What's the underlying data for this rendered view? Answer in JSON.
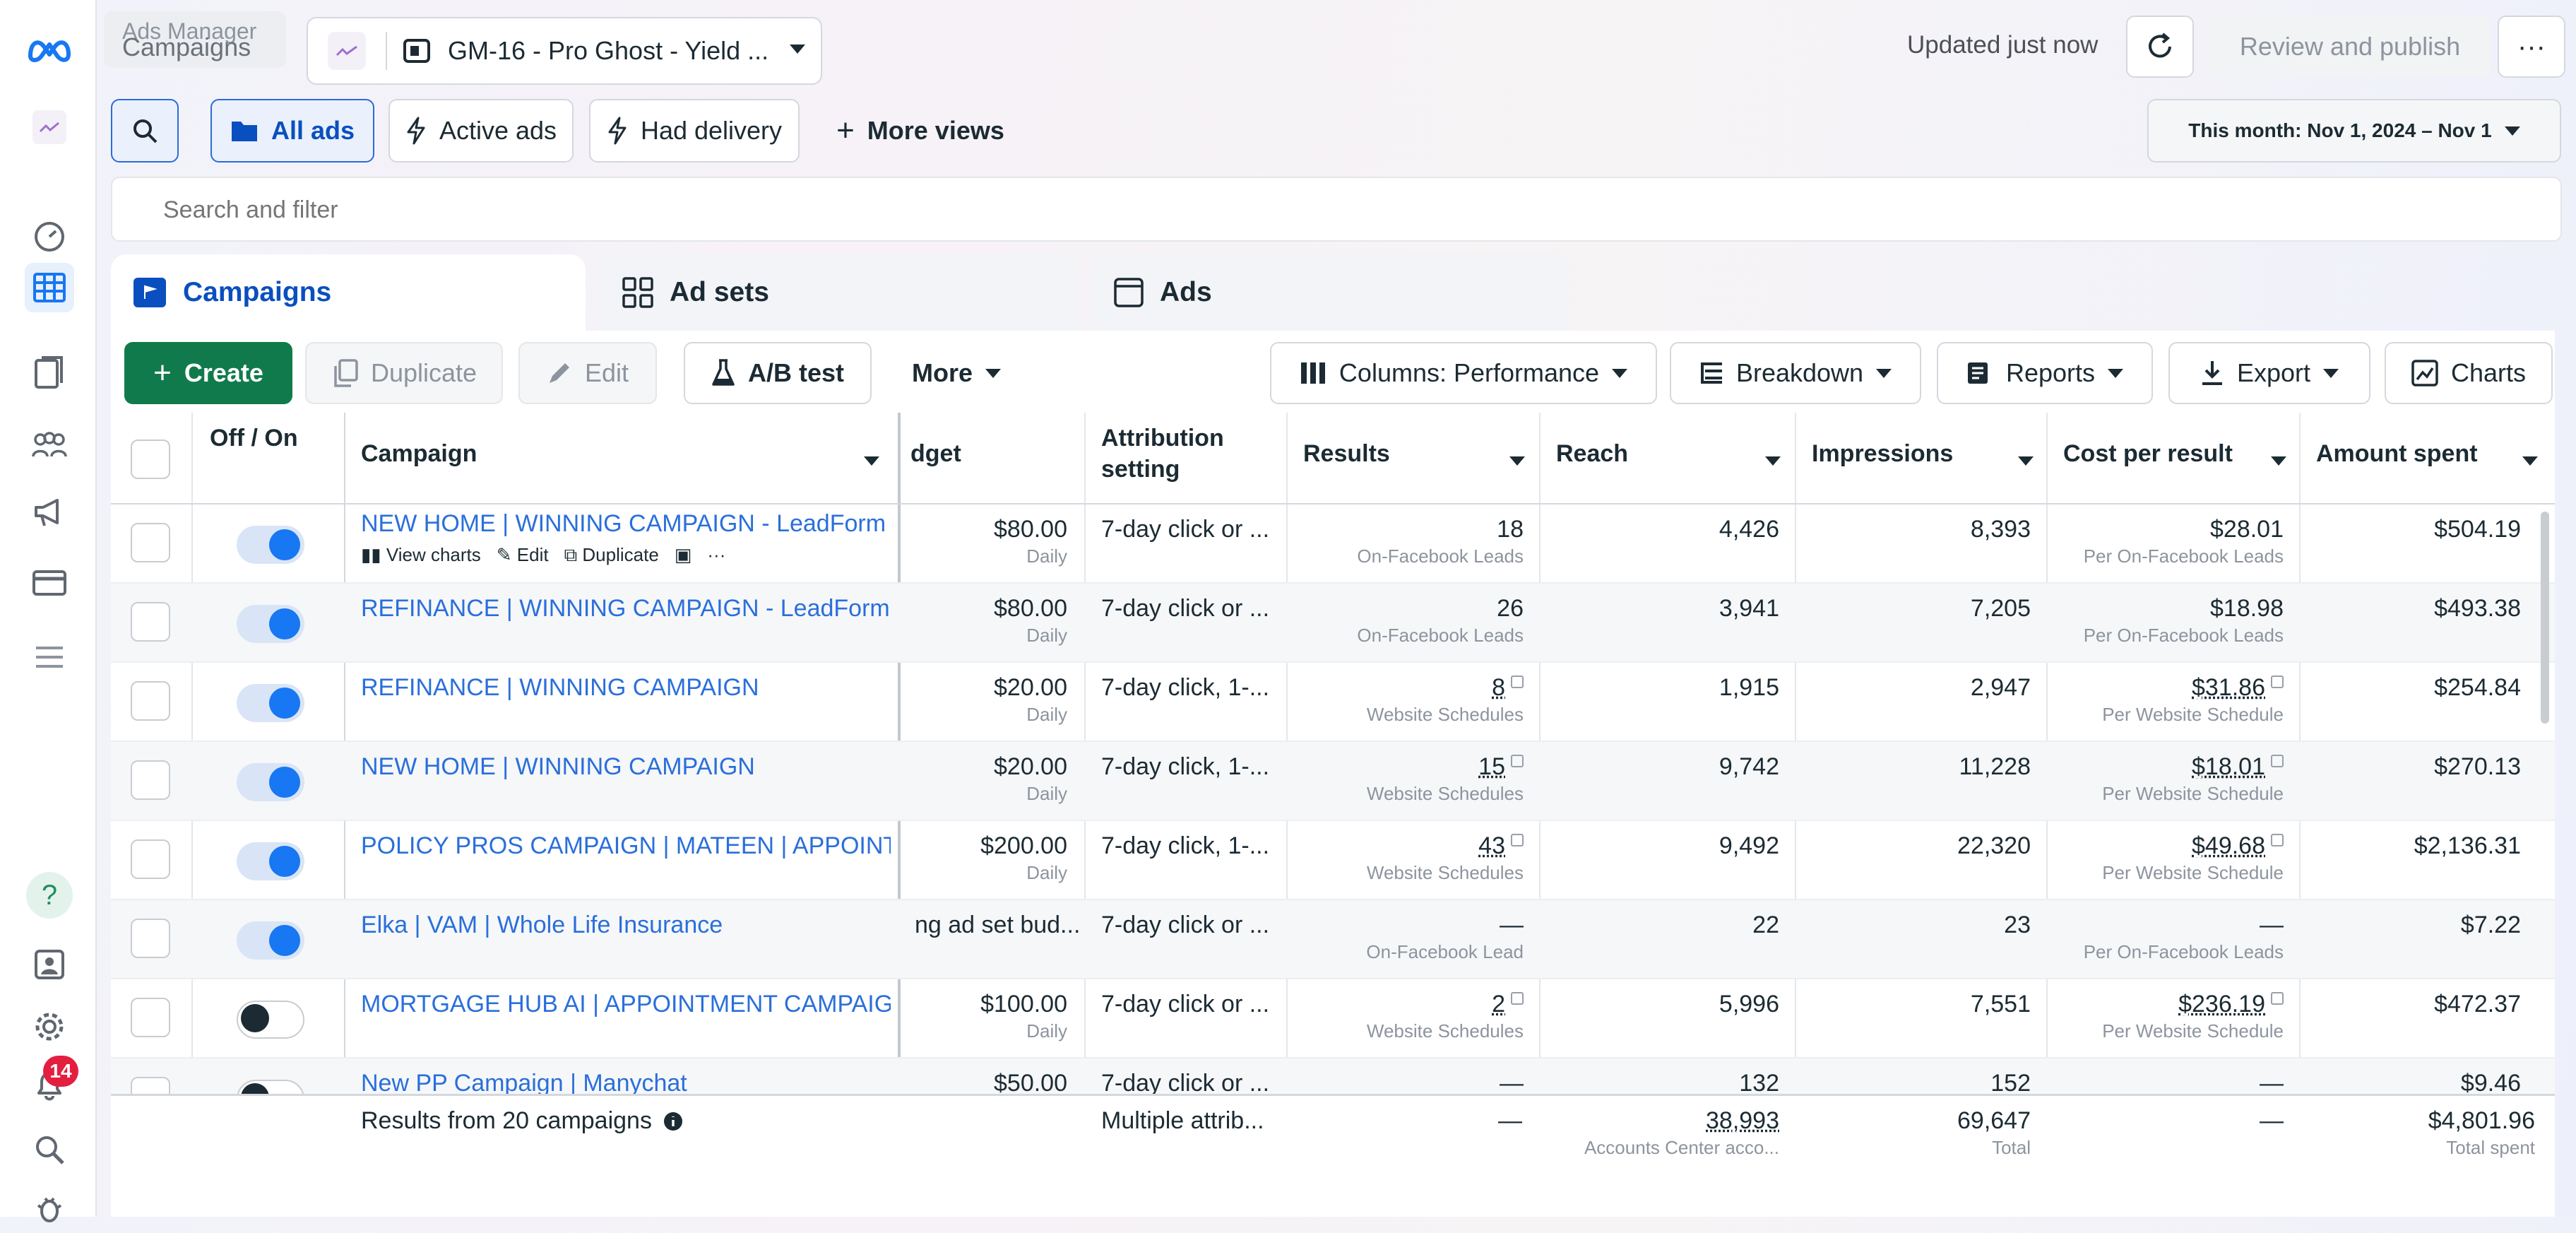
{
  "app": {
    "name": "Ads Manager",
    "section": "Campaigns",
    "account": "GM-16 - Pro Ghost - Yield ...",
    "updated": "Updated just now",
    "review_publish": "Review and publish",
    "notification_count": "14"
  },
  "views": {
    "all_ads": "All ads",
    "active_ads": "Active ads",
    "had_delivery": "Had delivery",
    "more_views": "More views",
    "date_range": "This month: Nov 1, 2024 – Nov 1"
  },
  "search": {
    "placeholder": "Search and filter"
  },
  "tabs": {
    "campaigns": "Campaigns",
    "ad_sets": "Ad sets",
    "ads": "Ads"
  },
  "toolbar": {
    "create": "Create",
    "duplicate": "Duplicate",
    "edit": "Edit",
    "ab_test": "A/B test",
    "more": "More",
    "columns": "Columns: Performance",
    "breakdown": "Breakdown",
    "reports": "Reports",
    "export": "Export",
    "charts": "Charts"
  },
  "table": {
    "headers": {
      "off_on": "Off / On",
      "campaign": "Campaign",
      "budget": "dget",
      "attribution": "Attribution setting",
      "results": "Results",
      "reach": "Reach",
      "impressions": "Impressions",
      "cost_per_result": "Cost per result",
      "amount_spent": "Amount spent"
    },
    "row_actions": {
      "view_charts": "View charts",
      "edit": "Edit",
      "duplicate": "Duplicate"
    },
    "rows": [
      {
        "on": true,
        "name": "NEW HOME | WINNING CAMPAIGN - LeadForm",
        "budget": "$80.00",
        "budget_type": "Daily",
        "attribution": "7-day click or ...",
        "results": "18",
        "results_type": "On-Facebook Leads",
        "reach": "4,426",
        "impressions": "8,393",
        "cpr": "$28.01",
        "cpr_type": "Per On-Facebook Leads",
        "spent": "$504.19"
      },
      {
        "on": true,
        "name": "REFINANCE | WINNING CAMPAIGN - LeadForm",
        "budget": "$80.00",
        "budget_type": "Daily",
        "attribution": "7-day click or ...",
        "results": "26",
        "results_type": "On-Facebook Leads",
        "reach": "3,941",
        "impressions": "7,205",
        "cpr": "$18.98",
        "cpr_type": "Per On-Facebook Leads",
        "spent": "$493.38"
      },
      {
        "on": true,
        "name": "REFINANCE | WINNING CAMPAIGN",
        "budget": "$20.00",
        "budget_type": "Daily",
        "attribution": "7-day click, 1-...",
        "results": "8",
        "results_type": "Website Schedules",
        "reach": "1,915",
        "impressions": "2,947",
        "cpr": "$31.86",
        "cpr_type": "Per Website Schedule",
        "spent": "$254.84"
      },
      {
        "on": true,
        "name": "NEW HOME | WINNING CAMPAIGN",
        "budget": "$20.00",
        "budget_type": "Daily",
        "attribution": "7-day click, 1-...",
        "results": "15",
        "results_type": "Website Schedules",
        "reach": "9,742",
        "impressions": "11,228",
        "cpr": "$18.01",
        "cpr_type": "Per Website Schedule",
        "spent": "$270.13"
      },
      {
        "on": true,
        "name": "POLICY PROS CAMPAIGN | MATEEN | APPOINT...",
        "budget": "$200.00",
        "budget_type": "Daily",
        "attribution": "7-day click, 1-...",
        "results": "43",
        "results_type": "Website Schedules",
        "reach": "9,492",
        "impressions": "22,320",
        "cpr": "$49.68",
        "cpr_type": "Per Website Schedule",
        "spent": "$2,136.31"
      },
      {
        "on": true,
        "name": "Elka | VAM | Whole Life Insurance",
        "budget": "ng ad set bud...",
        "budget_type": "",
        "attribution": "7-day click or ...",
        "results": "—",
        "results_type": "On-Facebook Lead",
        "reach": "22",
        "impressions": "23",
        "cpr": "—",
        "cpr_type": "Per On-Facebook Leads",
        "spent": "$7.22"
      },
      {
        "on": false,
        "name": "MORTGAGE HUB AI | APPOINTMENT CAMPAIGN",
        "budget": "$100.00",
        "budget_type": "Daily",
        "attribution": "7-day click or ...",
        "results": "2",
        "results_type": "Website Schedules",
        "reach": "5,996",
        "impressions": "7,551",
        "cpr": "$236.19",
        "cpr_type": "Per Website Schedule",
        "spent": "$472.37"
      },
      {
        "on": false,
        "name": "New PP Campaign | Manychat",
        "budget": "$50.00",
        "budget_type": "",
        "attribution": "7-day click or ...",
        "results": "—",
        "results_type": "",
        "reach": "132",
        "impressions": "152",
        "cpr": "—",
        "cpr_type": "",
        "spent": "$9.46"
      }
    ],
    "summary": {
      "label": "Results from 20 campaigns",
      "attribution": "Multiple attrib...",
      "results": "—",
      "reach": "38,993",
      "reach_note": "Accounts Center acco...",
      "impressions": "69,647",
      "impressions_note": "Total",
      "cpr": "—",
      "spent": "$4,801.96",
      "spent_note": "Total spent"
    }
  }
}
